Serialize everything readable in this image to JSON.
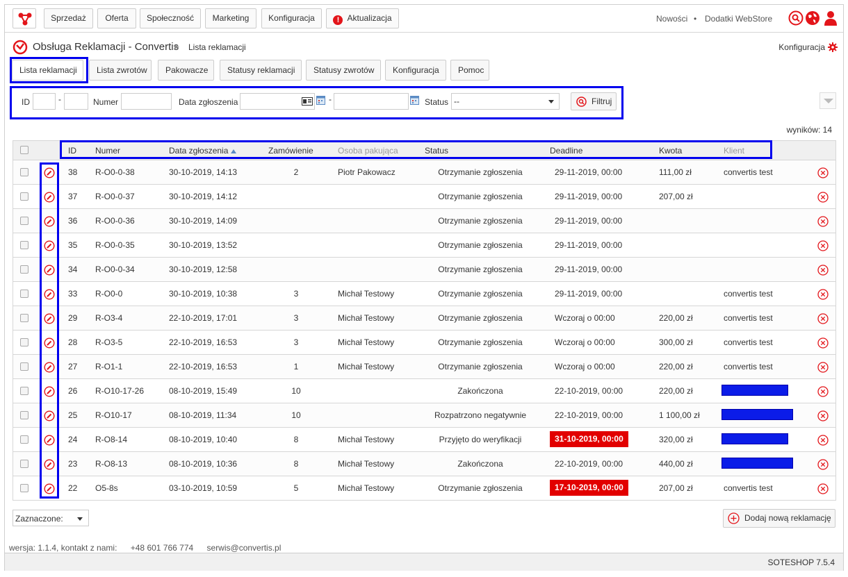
{
  "nav": {
    "items": [
      "Sprzedaż",
      "Oferta",
      "Społeczność",
      "Marketing",
      "Konfiguracja",
      "Aktualizacja"
    ],
    "alert_icon": "!",
    "links": [
      "Nowości",
      "•",
      "Dodatki WebStore"
    ],
    "icons": [
      "search-icon",
      "globe-icon",
      "user-icon"
    ]
  },
  "header": {
    "title": "Obsługa Reklamacji - Convertis",
    "separator": "▶",
    "current": "Lista reklamacji",
    "config_link": "Konfiguracja"
  },
  "tabs": [
    "Lista reklamacji",
    "Lista zwrotów",
    "Pakowacze",
    "Statusy reklamacji",
    "Statusy zwrotów",
    "Konfiguracja",
    "Pomoc"
  ],
  "filter": {
    "id_label": "ID",
    "dash": "-",
    "numer_label": "Numer",
    "date_label": "Data zgłoszenia",
    "status_label": "Status",
    "status_value": "--",
    "filter_button": "Filtruj"
  },
  "results_text": "wyników: 14",
  "table": {
    "columns": {
      "id": "ID",
      "numer": "Numer",
      "data": "Data zgłoszenia",
      "zamowienie": "Zamówienie",
      "osoba": "Osoba pakująca",
      "status": "Status",
      "deadline": "Deadline",
      "kwota": "Kwota",
      "klient": "Klient"
    },
    "rows": [
      {
        "id": "38",
        "numer": "R-O0-0-38",
        "data": "30-10-2019, 14:13",
        "zamowienie": "2",
        "osoba": "Piotr Pakowacz",
        "status": "Otrzymanie zgłoszenia",
        "deadline": "29-11-2019, 00:00",
        "deadline_overdue": false,
        "kwota": "111,00 zł",
        "klient": "convertis test",
        "klient_redacted": false
      },
      {
        "id": "37",
        "numer": "R-O0-0-37",
        "data": "30-10-2019, 14:12",
        "zamowienie": "",
        "osoba": "",
        "status": "Otrzymanie zgłoszenia",
        "deadline": "29-11-2019, 00:00",
        "deadline_overdue": false,
        "kwota": "207,00 zł",
        "klient": "",
        "klient_redacted": false
      },
      {
        "id": "36",
        "numer": "R-O0-0-36",
        "data": "30-10-2019, 14:09",
        "zamowienie": "",
        "osoba": "",
        "status": "Otrzymanie zgłoszenia",
        "deadline": "29-11-2019, 00:00",
        "deadline_overdue": false,
        "kwota": "",
        "klient": "",
        "klient_redacted": false
      },
      {
        "id": "35",
        "numer": "R-O0-0-35",
        "data": "30-10-2019, 13:52",
        "zamowienie": "",
        "osoba": "",
        "status": "Otrzymanie zgłoszenia",
        "deadline": "29-11-2019, 00:00",
        "deadline_overdue": false,
        "kwota": "",
        "klient": "",
        "klient_redacted": false
      },
      {
        "id": "34",
        "numer": "R-O0-0-34",
        "data": "30-10-2019, 12:58",
        "zamowienie": "",
        "osoba": "",
        "status": "Otrzymanie zgłoszenia",
        "deadline": "29-11-2019, 00:00",
        "deadline_overdue": false,
        "kwota": "",
        "klient": "",
        "klient_redacted": false
      },
      {
        "id": "33",
        "numer": "R-O0-0",
        "data": "30-10-2019, 10:38",
        "zamowienie": "3",
        "osoba": "Michał Testowy",
        "status": "Otrzymanie zgłoszenia",
        "deadline": "29-11-2019, 00:00",
        "deadline_overdue": false,
        "kwota": "",
        "klient": "convertis test",
        "klient_redacted": false
      },
      {
        "id": "29",
        "numer": "R-O3-4",
        "data": "22-10-2019, 17:01",
        "zamowienie": "3",
        "osoba": "Michał Testowy",
        "status": "Otrzymanie zgłoszenia",
        "deadline": "Wczoraj o 00:00",
        "deadline_overdue": false,
        "kwota": "220,00 zł",
        "klient": "convertis test",
        "klient_redacted": false
      },
      {
        "id": "28",
        "numer": "R-O3-5",
        "data": "22-10-2019, 16:53",
        "zamowienie": "3",
        "osoba": "Michał Testowy",
        "status": "Otrzymanie zgłoszenia",
        "deadline": "Wczoraj o 00:00",
        "deadline_overdue": false,
        "kwota": "300,00 zł",
        "klient": "convertis test",
        "klient_redacted": false
      },
      {
        "id": "27",
        "numer": "R-O1-1",
        "data": "22-10-2019, 16:53",
        "zamowienie": "1",
        "osoba": "Michał Testowy",
        "status": "Otrzymanie zgłoszenia",
        "deadline": "Wczoraj o 00:00",
        "deadline_overdue": false,
        "kwota": "220,00 zł",
        "klient": "convertis test",
        "klient_redacted": false
      },
      {
        "id": "26",
        "numer": "R-O10-17-26",
        "data": "08-10-2019, 15:49",
        "zamowienie": "10",
        "osoba": "",
        "status": "Zakończona",
        "deadline": "22-10-2019, 00:00",
        "deadline_overdue": false,
        "kwota": "220,00 zł",
        "klient": "",
        "klient_redacted": true
      },
      {
        "id": "25",
        "numer": "R-O10-17",
        "data": "08-10-2019, 11:34",
        "zamowienie": "10",
        "osoba": "",
        "status": "Rozpatrzono negatywnie",
        "deadline": "22-10-2019, 00:00",
        "deadline_overdue": false,
        "kwota": "1 100,00 zł",
        "klient": "",
        "klient_redacted": true
      },
      {
        "id": "24",
        "numer": "R-O8-14",
        "data": "08-10-2019, 10:40",
        "zamowienie": "8",
        "osoba": "Michał Testowy",
        "status": "Przyjęto do weryfikacji",
        "deadline": "31-10-2019, 00:00",
        "deadline_overdue": true,
        "kwota": "320,00 zł",
        "klient": "",
        "klient_redacted": true
      },
      {
        "id": "23",
        "numer": "R-O8-13",
        "data": "08-10-2019, 10:36",
        "zamowienie": "8",
        "osoba": "Michał Testowy",
        "status": "Zakończona",
        "deadline": "22-10-2019, 00:00",
        "deadline_overdue": false,
        "kwota": "440,00 zł",
        "klient": "",
        "klient_redacted": true
      },
      {
        "id": "22",
        "numer": "O5-8s",
        "data": "03-10-2019, 10:59",
        "zamowienie": "5",
        "osoba": "Michał Testowy",
        "status": "Otrzymanie zgłoszenia",
        "deadline": "17-10-2019, 00:00",
        "deadline_overdue": true,
        "kwota": "207,00 zł",
        "klient": "convertis test",
        "klient_redacted": false
      }
    ]
  },
  "bulk_select": "Zaznaczone:",
  "add_button": "Dodaj nową reklamację",
  "footer": {
    "version": "wersja: 1.1.4, kontakt z nami:",
    "phone": "+48 601 766 774",
    "email": "serwis@convertis.pl",
    "brand": "SOTESHOP 7.5.4"
  },
  "colors": {
    "accent_red": "#e3151a",
    "overdue_bg": "#e20000",
    "highlight_blue": "#0000ee"
  }
}
